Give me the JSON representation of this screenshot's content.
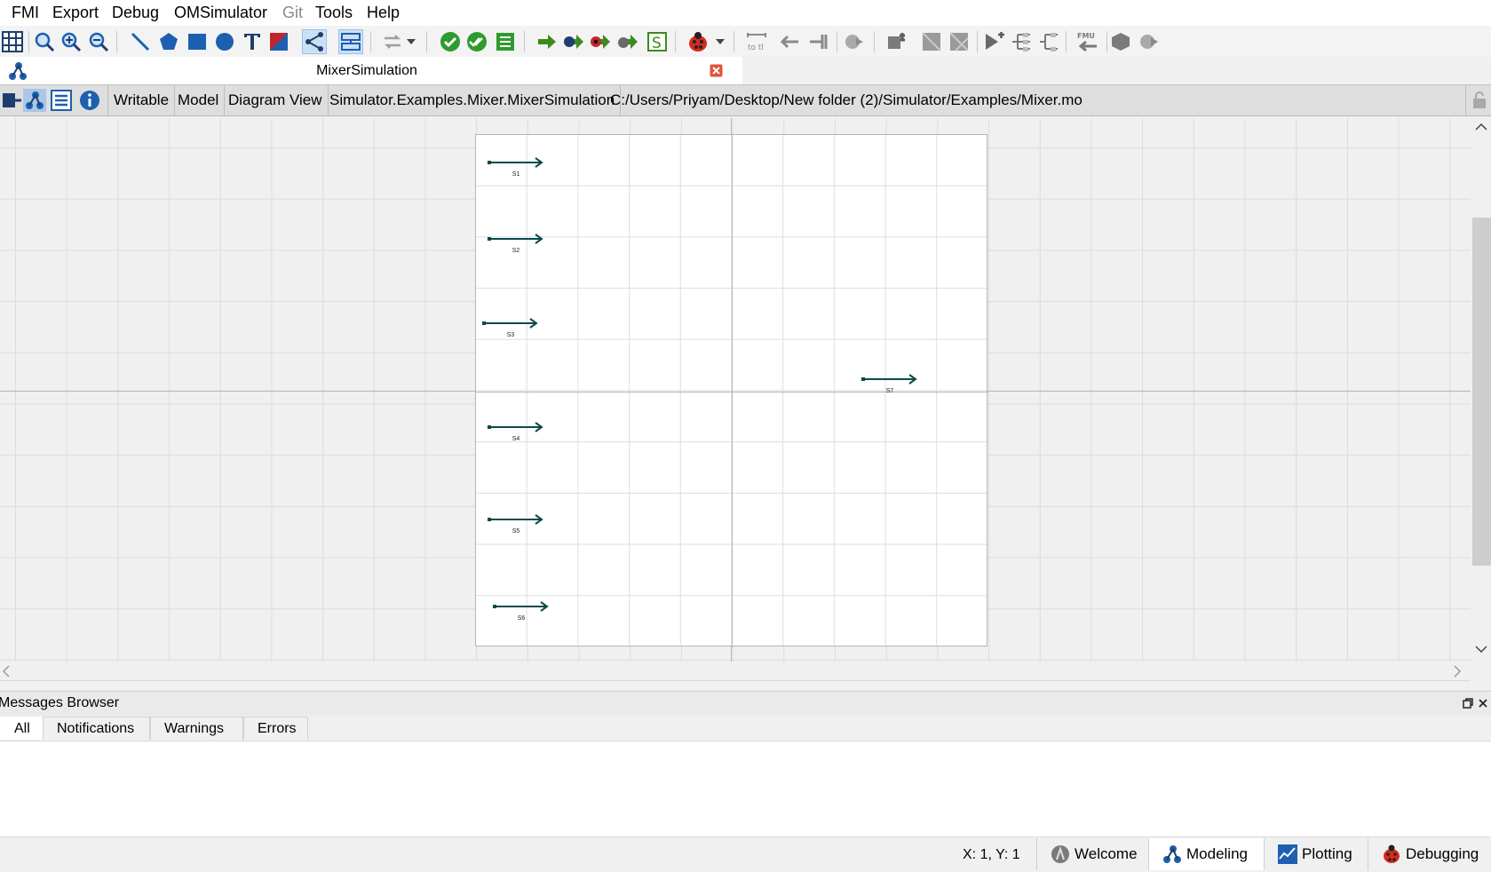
{
  "menu": [
    "FMI",
    "Export",
    "Debug",
    "OMSimulator",
    "Git",
    "Tools",
    "Help"
  ],
  "document": {
    "title": "MixerSimulation"
  },
  "infobar": {
    "access": "Writable",
    "restriction": "Model",
    "view": "Diagram View",
    "class_name": "Simulator.Examples.Mixer.MixerSimulation",
    "file_path": "C:/Users/Priyam/Desktop/New folder (2)/Simulator/Examples/Mixer.mo"
  },
  "diagram": {
    "components": [
      {
        "id": "s1",
        "label": "S1"
      },
      {
        "id": "s2",
        "label": "S2"
      },
      {
        "id": "s3",
        "label": "S3"
      },
      {
        "id": "s4",
        "label": "S4"
      },
      {
        "id": "s5",
        "label": "S5"
      },
      {
        "id": "s6",
        "label": "S6"
      },
      {
        "id": "s7",
        "label": "S7"
      }
    ]
  },
  "messages": {
    "title": "Messages Browser",
    "tabs": [
      "All",
      "Notifications",
      "Warnings",
      "Errors"
    ],
    "active_tab": "All"
  },
  "statusbar": {
    "coordinates": "X: 1, Y: 1",
    "perspectives": [
      "Welcome",
      "Modeling",
      "Plotting",
      "Debugging"
    ],
    "active_perspective": "Modeling"
  },
  "colors": {
    "arrow": "#0d4a4a",
    "active_bg": "#cce0f5"
  }
}
